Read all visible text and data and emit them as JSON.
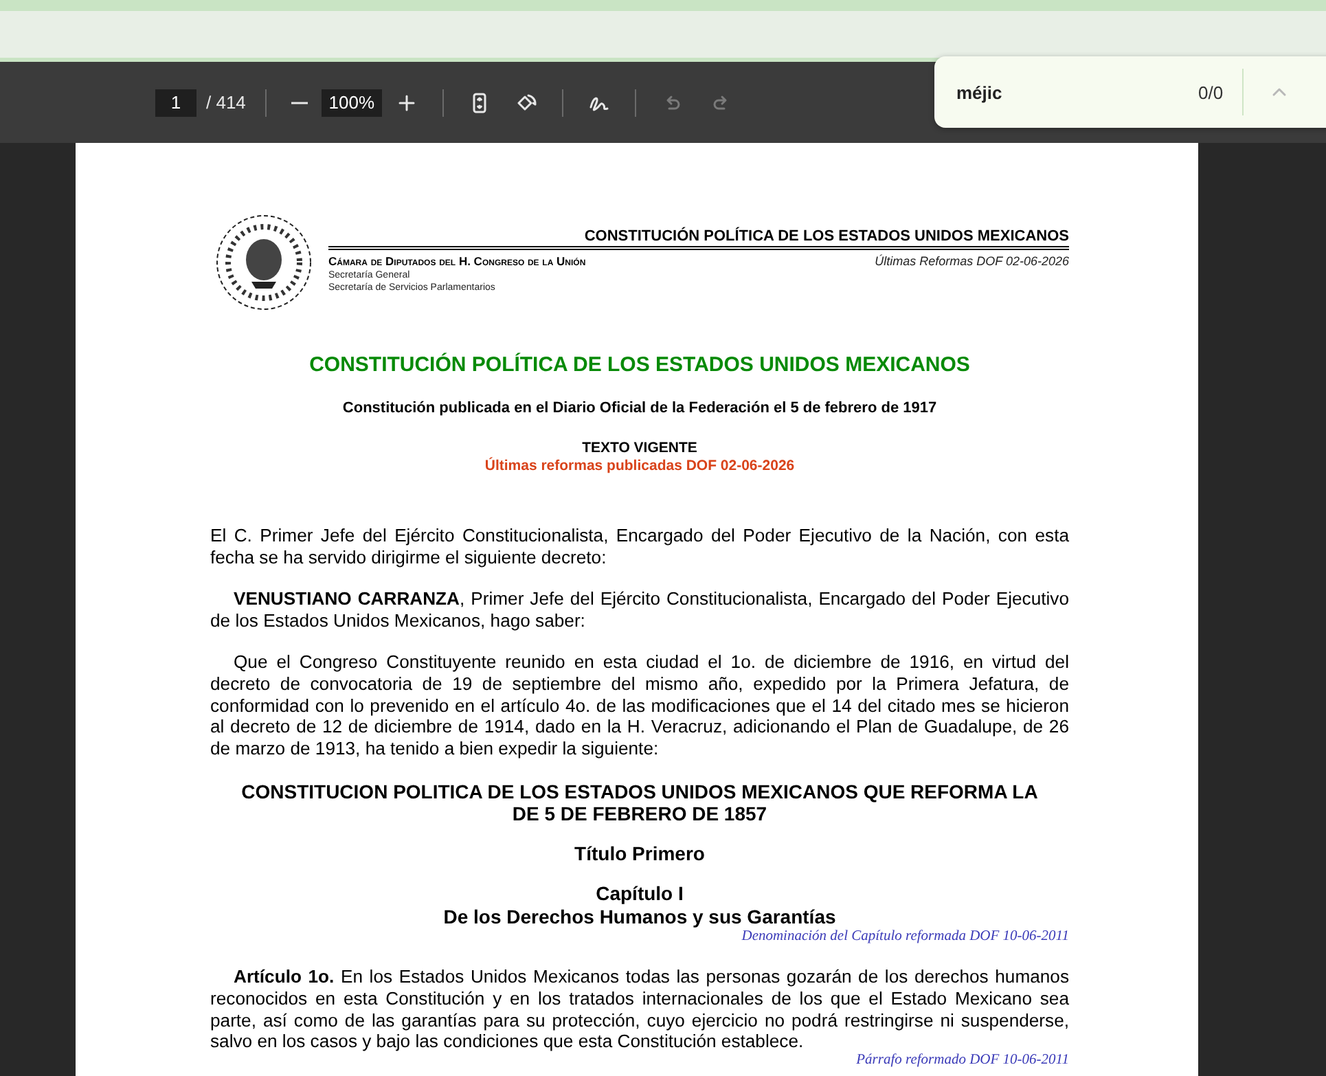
{
  "toolbar": {
    "page_number": "1",
    "page_count": "/ 414",
    "zoom": "100%",
    "undo": {
      "disabled": true
    },
    "redo": {
      "disabled": true
    }
  },
  "find_bar": {
    "query": "méjic",
    "count": "0/0",
    "previous": {
      "disabled": true
    }
  },
  "document": {
    "header": {
      "title": "CONSTITUCIÓN POLÍTICA DE LOS ESTADOS UNIDOS MEXICANOS",
      "chamber": "Cámara de Diputados del H. Congreso de la Unión",
      "lines": [
        "Secretaría General",
        "Secretaría de Servicios Parlamentarios"
      ],
      "reforms": "Últimas Reformas DOF 02-06-2026"
    },
    "blocks": [
      {
        "kind": "title",
        "text": "CONSTITUCIÓN POLÍTICA DE LOS ESTADOS UNIDOS MEXICANOS"
      },
      {
        "kind": "subtitle",
        "text": "Constitución publicada en el Diario Oficial de la Federación el 5 de febrero de 1917"
      },
      {
        "kind": "label",
        "text": "TEXTO VIGENTE"
      },
      {
        "kind": "reform",
        "text": "Últimas reformas publicadas DOF 02-06-2026"
      },
      {
        "kind": "paragraph",
        "indent": false,
        "text": "El C. Primer Jefe del Ejército Constitucionalista, Encargado del Poder Ejecutivo de la Nación, con esta fecha se ha servido dirigirme el siguiente decreto:"
      },
      {
        "kind": "paragraph",
        "indent": true,
        "text": "**VENUSTIANO CARRANZA**, Primer Jefe del Ejército Constitucionalista, Encargado del Poder Ejecutivo de los Estados Unidos Mexicanos, hago saber:"
      },
      {
        "kind": "paragraph",
        "indent": true,
        "text": "Que el Congreso Constituyente reunido en esta ciudad el 1o. de diciembre de 1916, en virtud del decreto de convocatoria de 19 de septiembre del mismo año, expedido por la Primera Jefatura, de conformidad con lo prevenido en el artículo 4o. de las modificaciones que el 14 del citado mes se hicieron al decreto de 12 de diciembre de 1914, dado en la H. Veracruz, adicionando el Plan de Guadalupe, de 26 de marzo de 1913, ha tenido a bien expedir la siguiente:"
      },
      {
        "kind": "heading",
        "text": "CONSTITUCION POLITICA DE LOS ESTADOS UNIDOS MEXICANOS QUE REFORMA LA DE 5 DE FEBRERO DE 1857"
      },
      {
        "kind": "section",
        "text": "Título Primero"
      },
      {
        "kind": "chapter",
        "text": "Capítulo I"
      },
      {
        "kind": "chapter-name",
        "text": "De los Derechos Humanos y sus Garantías"
      },
      {
        "kind": "note",
        "text": "Denominación del Capítulo reformada DOF 10-06-2011"
      },
      {
        "kind": "paragraph",
        "indent": true,
        "text": "**Artículo 1o.** En los Estados Unidos Mexicanos todas las personas gozarán de los derechos humanos reconocidos en esta Constitución y en los tratados internacionales de los que el Estado Mexicano sea parte, así como de las garantías para su protección, cuyo ejercicio no podrá restringirse ni suspenderse, salvo en los casos y bajo las condiciones que esta Constitución establece."
      },
      {
        "kind": "note",
        "text": "Párrafo reformado DOF 10-06-2011"
      }
    ]
  }
}
